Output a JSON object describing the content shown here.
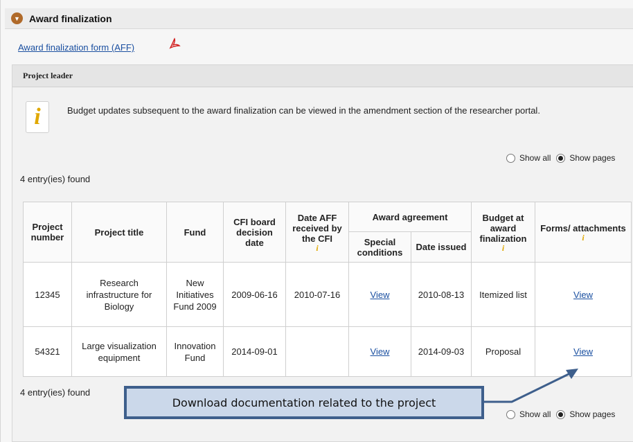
{
  "section": {
    "title": "Award finalization"
  },
  "aff": {
    "link_label": "Award finalization form (AFF)"
  },
  "panel": {
    "title": "Project leader"
  },
  "info": {
    "message": "Budget updates subsequent to the award finalization can be viewed in the amendment section of the researcher portal."
  },
  "view_toggle": {
    "show_all": "Show all",
    "show_pages": "Show pages",
    "selected": "Show pages"
  },
  "entries": {
    "count_label": "4 entry(ies) found"
  },
  "table": {
    "headers": {
      "project_number": "Project number",
      "project_title": "Project title",
      "fund": "Fund",
      "cfi_board_decision_date": "CFI board decision date",
      "date_aff_received": "Date AFF received by the CFI",
      "award_agreement": "Award agreement",
      "special_conditions": "Special conditions",
      "date_issued": "Date issued",
      "budget_at_award_finalization": "Budget at award finalization",
      "forms_attachments": "Forms/ attachments"
    },
    "rows": [
      {
        "project_number": "12345",
        "project_title": "Research infrastructure for Biology",
        "fund": "New Initiatives Fund 2009",
        "cfi_board_decision_date": "2009-06-16",
        "date_aff_received": "2010-07-16",
        "special_conditions": "View",
        "date_issued": "2010-08-13",
        "budget": "Itemized list",
        "forms": "View"
      },
      {
        "project_number": "54321",
        "project_title": "Large visualization equipment",
        "fund": "Innovation Fund",
        "cfi_board_decision_date": "2014-09-01",
        "date_aff_received": "",
        "special_conditions": "View",
        "date_issued": "2014-09-03",
        "budget": "Proposal",
        "forms": "View"
      }
    ]
  },
  "callout": {
    "text": "Download documentation related to the project"
  },
  "icons": {
    "collapse": "chevron-down-circle-icon",
    "pdf": "pdf-icon",
    "info": "info-icon",
    "info_small": "info-small-icon"
  },
  "colors": {
    "link": "#1a4fa0",
    "info_glyph": "#e0a800",
    "callout_border": "#3e5f8c",
    "callout_fill": "#cbd8ea"
  }
}
